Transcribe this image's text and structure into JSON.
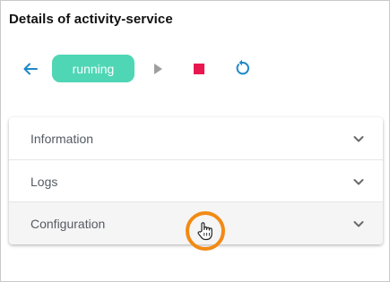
{
  "page": {
    "title": "Details of activity-service"
  },
  "toolbar": {
    "back_icon": "arrow-left-icon",
    "status_label": "running",
    "play_icon": "play-icon",
    "stop_icon": "stop-icon",
    "restart_icon": "restart-icon"
  },
  "accordion": {
    "items": [
      {
        "label": "Information"
      },
      {
        "label": "Logs"
      },
      {
        "label": "Configuration"
      }
    ]
  },
  "colors": {
    "accent": "#1e88c7",
    "status_running": "#4fd6b5",
    "stop": "#e8174f",
    "play_disabled": "#9e9e9e",
    "cursor_highlight": "#f28a14"
  }
}
